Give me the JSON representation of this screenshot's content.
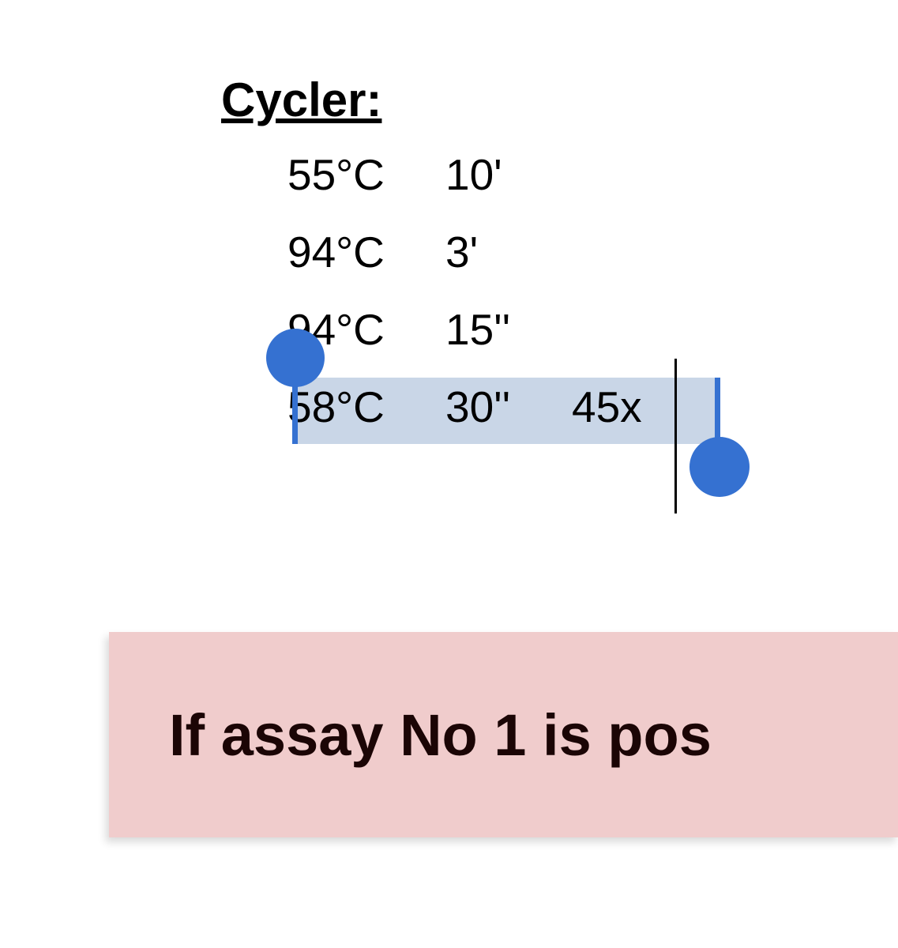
{
  "cycler": {
    "heading": "Cycler:",
    "steps": [
      {
        "temp": "55°C",
        "time": "10'",
        "cycles": ""
      },
      {
        "temp": "94°C",
        "time": "3'",
        "cycles": ""
      },
      {
        "temp": "94°C",
        "time": "15''",
        "cycles": ""
      },
      {
        "temp": "58°C",
        "time": "30''",
        "cycles": "45x"
      }
    ]
  },
  "note": {
    "text": "If assay No 1 is pos"
  },
  "colors": {
    "selection_dot": "#3571d1",
    "selection_highlight": "#c9d6e7",
    "note_bg": "#f0cccc"
  }
}
